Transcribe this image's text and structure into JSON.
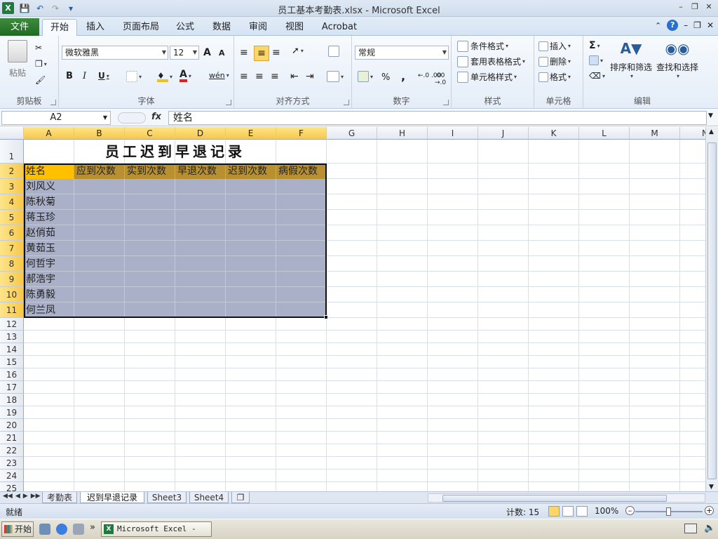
{
  "window": {
    "title": "员工基本考勤表.xlsx - Microsoft Excel",
    "app_icon": "X"
  },
  "tabs": {
    "file": "文件",
    "items": [
      "开始",
      "插入",
      "页面布局",
      "公式",
      "数据",
      "审阅",
      "视图",
      "Acrobat"
    ]
  },
  "ribbon": {
    "clipboard": {
      "paste": "粘贴",
      "label": "剪贴板"
    },
    "font": {
      "name": "微软雅黑",
      "size": "12",
      "bold": "B",
      "italic": "I",
      "underline": "U",
      "label": "字体",
      "grow": "A",
      "shrink": "A",
      "font_color": "A",
      "phonetic": "wén"
    },
    "alignment": {
      "label": "对齐方式"
    },
    "number": {
      "format": "常规",
      "percent": "%",
      "comma": ",",
      "inc_dec": "←.0 .00",
      "dec_dec": ".00 →.0",
      "label": "数字"
    },
    "styles": {
      "conditional": "条件格式",
      "table": "套用表格格式",
      "cell_styles": "单元格样式",
      "label": "样式"
    },
    "cells": {
      "insert": "插入",
      "delete": "删除",
      "format": "格式",
      "label": "单元格"
    },
    "editing": {
      "sigma": "Σ",
      "sort_filter": "排序和筛选",
      "find_select": "查找和选择",
      "label": "编辑"
    }
  },
  "formula_bar": {
    "name_box": "A2",
    "fx": "fx",
    "content": "姓名"
  },
  "sheet": {
    "columns": [
      "A",
      "B",
      "C",
      "D",
      "E",
      "F",
      "G",
      "H",
      "I",
      "J",
      "K",
      "L",
      "M",
      "N"
    ],
    "rows": [
      "1",
      "2",
      "3",
      "4",
      "5",
      "6",
      "7",
      "8",
      "9",
      "10",
      "11",
      "12",
      "13",
      "14",
      "15",
      "16",
      "17",
      "18",
      "19",
      "20",
      "21",
      "22",
      "23",
      "24",
      "25"
    ],
    "title": "员工迟到早退记录",
    "headers": [
      "姓名",
      "应到次数",
      "实到次数",
      "早退次数",
      "迟到次数",
      "病假次数"
    ],
    "names": [
      "刘风义",
      "陈秋菊",
      "蒋玉珍",
      "赵俏茹",
      "黄茹玉",
      "何哲宇",
      "郝浩宇",
      "陈勇毅",
      "何兰凤"
    ]
  },
  "sheet_tabs": [
    "考勤表",
    "迟到早退记录",
    "Sheet3",
    "Sheet4"
  ],
  "status": {
    "ready": "就绪",
    "count": "计数: 15",
    "zoom": "100%"
  },
  "taskbar": {
    "start": "开始",
    "task": "Microsoft Excel - ...",
    "chevron": "»"
  },
  "colors": {
    "header_fill": "#b8902f",
    "body_fill": "#a9b0c8",
    "selected_fill": "#ffc000",
    "excel_green": "#1e7a3d"
  }
}
